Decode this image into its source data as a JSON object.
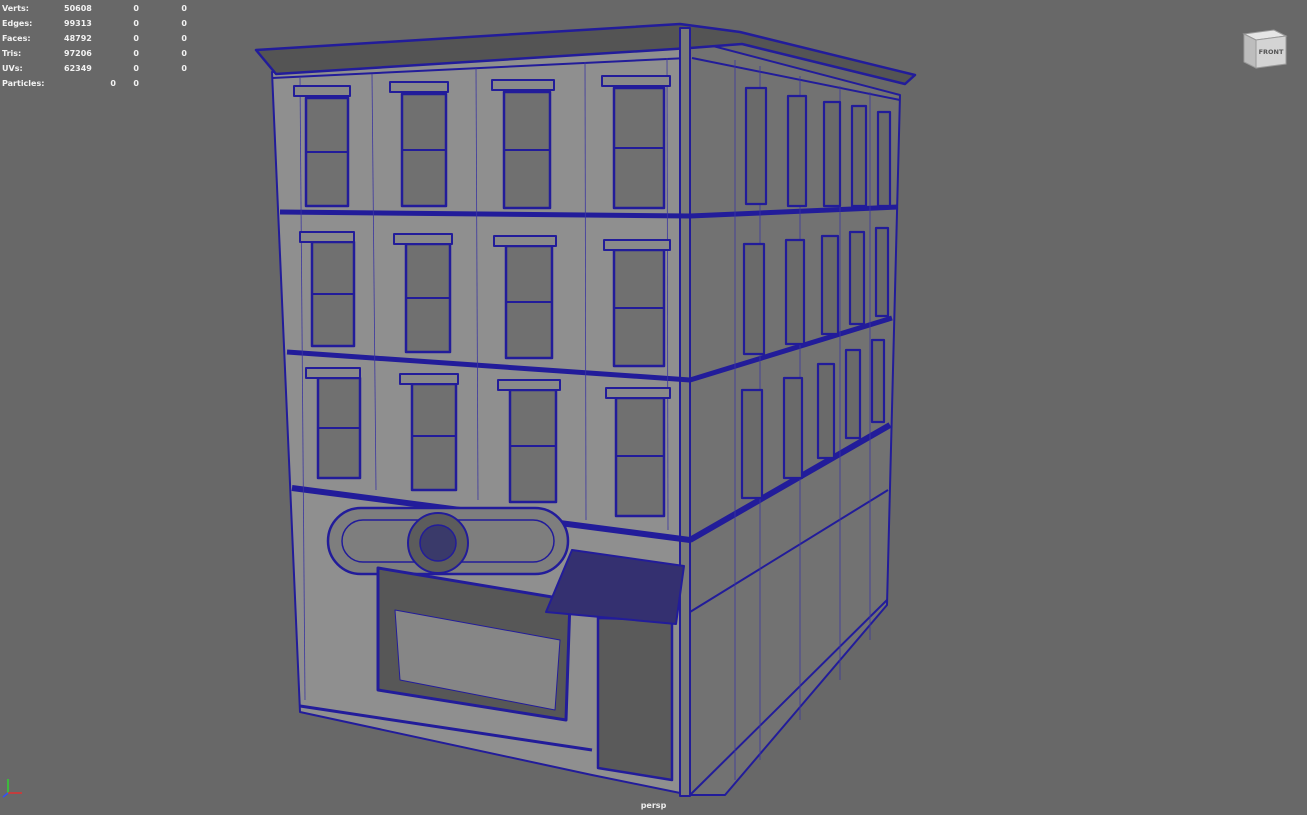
{
  "hud": {
    "rows": [
      {
        "label": "Verts:",
        "v1": "50608",
        "v2": "0",
        "v3": "0"
      },
      {
        "label": "Edges:",
        "v1": "99313",
        "v2": "0",
        "v3": "0"
      },
      {
        "label": "Faces:",
        "v1": "48792",
        "v2": "0",
        "v3": "0"
      },
      {
        "label": "Tris:",
        "v1": "97206",
        "v2": "0",
        "v3": "0"
      },
      {
        "label": "UVs:",
        "v1": "62349",
        "v2": "0",
        "v3": "0"
      }
    ],
    "particles": {
      "label": "Particles:",
      "v1": "0",
      "v2": "0"
    }
  },
  "view_cube": {
    "label": "FRONT"
  },
  "camera_label": "persp",
  "colors": {
    "background": "#686868",
    "wire": "#1f1a9e",
    "face_light": "#8c8c8c",
    "face_dark": "#6c6c6c",
    "hud_text": "#f2f2f2"
  }
}
